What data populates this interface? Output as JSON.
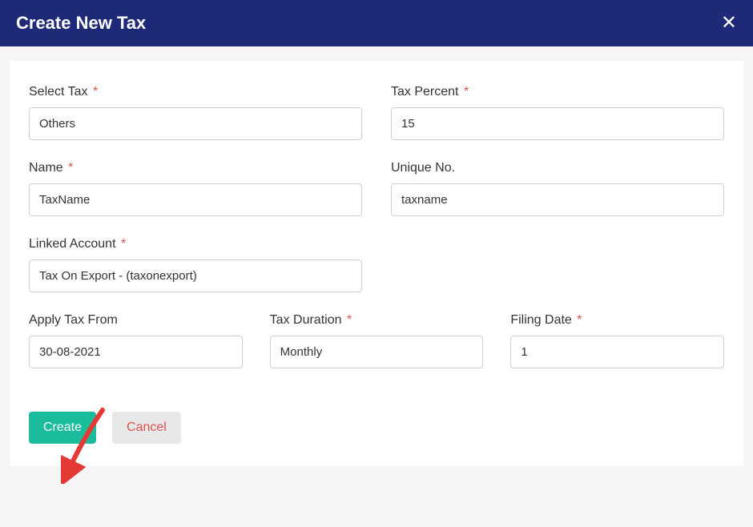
{
  "header": {
    "title": "Create New Tax",
    "close": "✕"
  },
  "fields": {
    "selectTax": {
      "label": "Select Tax",
      "value": "Others",
      "required": "*"
    },
    "taxPercent": {
      "label": "Tax Percent",
      "value": "15",
      "required": "*"
    },
    "name": {
      "label": "Name",
      "value": "TaxName",
      "required": "*"
    },
    "uniqueNo": {
      "label": "Unique No.",
      "value": "taxname"
    },
    "linkedAccount": {
      "label": "Linked Account",
      "value": "Tax On Export - (taxonexport)",
      "required": "*"
    },
    "applyTaxFrom": {
      "label": "Apply Tax From",
      "value": "30-08-2021"
    },
    "taxDuration": {
      "label": "Tax Duration",
      "value": "Monthly",
      "required": "*"
    },
    "filingDate": {
      "label": "Filing Date",
      "value": "1",
      "required": "*"
    }
  },
  "buttons": {
    "create": "Create",
    "cancel": "Cancel"
  }
}
